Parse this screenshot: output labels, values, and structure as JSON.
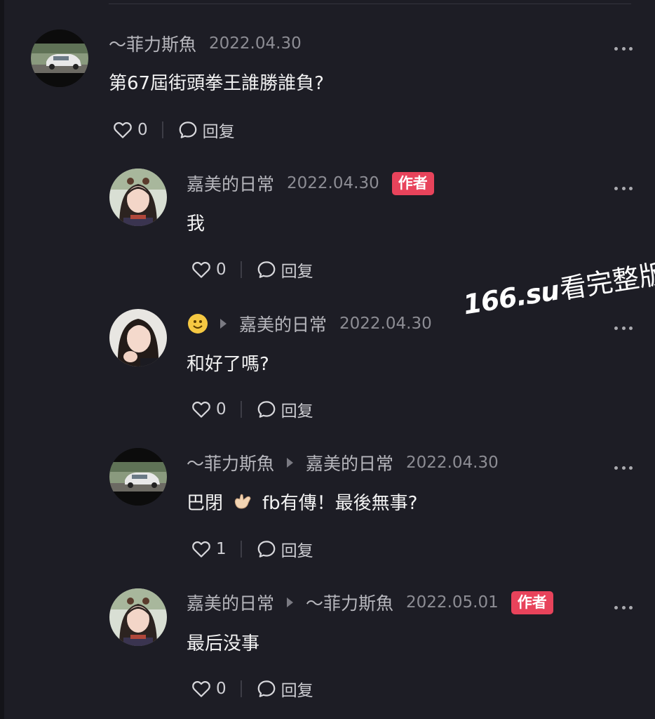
{
  "comments": [
    {
      "user": "～菲力斯魚",
      "date": "2022.04.30",
      "text": "第67屆街頭拳王誰勝誰負?",
      "likes": "0",
      "reply_label": "回复",
      "avatar": "car-avatar"
    },
    {
      "user": "嘉美的日常",
      "date": "2022.04.30",
      "badge": "作者",
      "text": "我",
      "likes": "0",
      "reply_label": "回复",
      "avatar": "girl-avatar"
    },
    {
      "user": "嘉美的日常",
      "date": "2022.04.30",
      "text": "和好了嗎?",
      "likes": "0",
      "reply_label": "回复",
      "avatar": "girl-avatar-2",
      "reply_from_icon": "smiley-emoji-icon"
    },
    {
      "user": "～菲力斯魚",
      "reply_to": "嘉美的日常",
      "date": "2022.04.30",
      "text_part1": "巴閉",
      "text_part2": "fb有傳！最後無事?",
      "likes": "1",
      "reply_label": "回复",
      "avatar": "car-avatar"
    },
    {
      "user": "嘉美的日常",
      "reply_to": "～菲力斯魚",
      "date": "2022.05.01",
      "badge": "作者",
      "text": "最后没事",
      "likes": "0",
      "reply_label": "回复",
      "avatar": "girl-avatar"
    }
  ],
  "watermark": {
    "site": "166.su",
    "suffix": "看完整版"
  },
  "colors": {
    "background": "#1d1d25",
    "badge": "#e8435b",
    "username": "#b7b7bd",
    "date": "#8d8d94"
  }
}
